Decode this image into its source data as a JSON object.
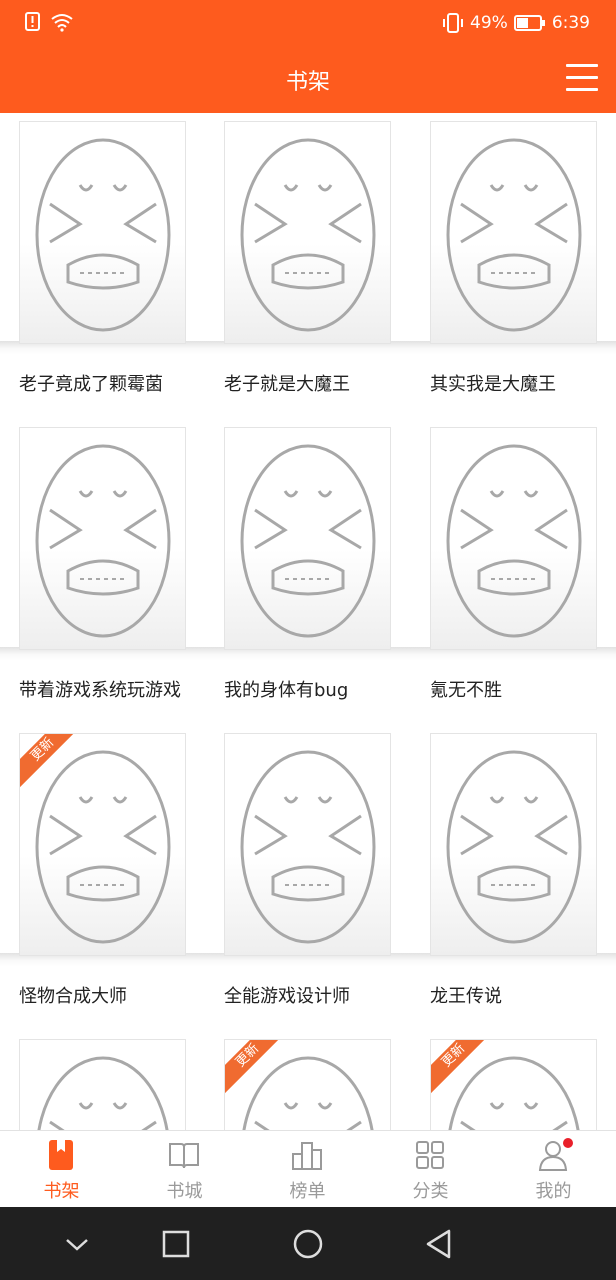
{
  "status_bar": {
    "battery": "49%",
    "time": "6:39"
  },
  "header": {
    "title": "书架"
  },
  "books": [
    {
      "title": "老子竟成了颗霉菌",
      "update_badge": ""
    },
    {
      "title": "老子就是大魔王",
      "update_badge": ""
    },
    {
      "title": "其实我是大魔王",
      "update_badge": ""
    },
    {
      "title": "带着游戏系统玩游戏",
      "update_badge": ""
    },
    {
      "title": "我的身体有bug",
      "update_badge": ""
    },
    {
      "title": "氪无不胜",
      "update_badge": ""
    },
    {
      "title": "怪物合成大师",
      "update_badge": "更新"
    },
    {
      "title": "全能游戏设计师",
      "update_badge": ""
    },
    {
      "title": "龙王传说",
      "update_badge": ""
    },
    {
      "title": "",
      "update_badge": ""
    },
    {
      "title": "",
      "update_badge": "更新"
    },
    {
      "title": "",
      "update_badge": "更新"
    }
  ],
  "tabs": [
    {
      "label": "书架",
      "icon": "bookmark-icon",
      "active": true
    },
    {
      "label": "书城",
      "icon": "open-book-icon",
      "active": false
    },
    {
      "label": "榜单",
      "icon": "ranking-icon",
      "active": false
    },
    {
      "label": "分类",
      "icon": "grid-icon",
      "active": false
    },
    {
      "label": "我的",
      "icon": "user-icon",
      "active": false,
      "notification": true
    }
  ],
  "colors": {
    "accent": "#fe5b1e",
    "badge": "#f06b30",
    "notification": "#e9202a",
    "navbar": "#202020"
  }
}
